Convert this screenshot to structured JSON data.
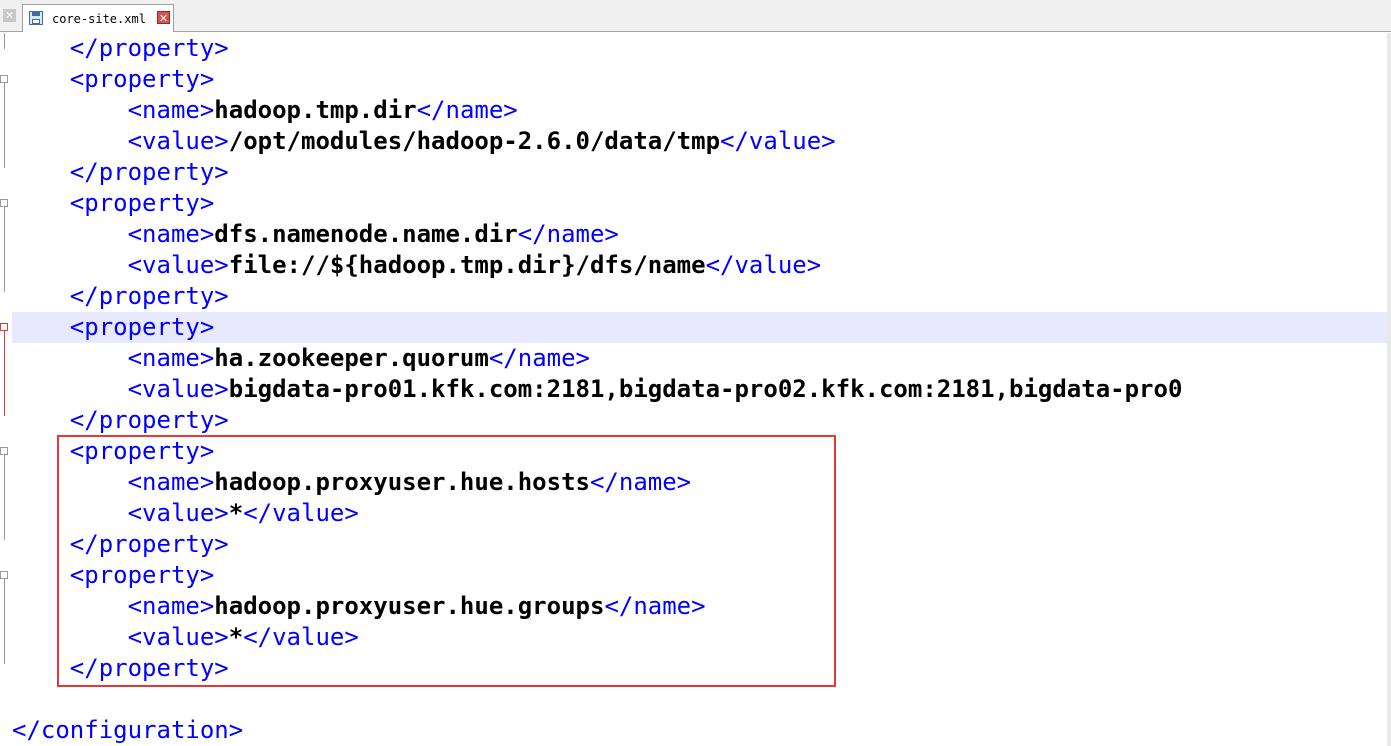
{
  "tabbar": {
    "close_all_glyph": "✕",
    "tab_label": "core-site.xml",
    "tab_close_glyph": "✕"
  },
  "code": {
    "lines": [
      {
        "indent": "    ",
        "open": "</property>",
        "text": "",
        "close": ""
      },
      {
        "indent": "    ",
        "open": "<property>",
        "text": "",
        "close": ""
      },
      {
        "indent": "        ",
        "open": "<name>",
        "text": "hadoop.tmp.dir",
        "close": "</name>"
      },
      {
        "indent": "        ",
        "open": "<value>",
        "text": "/opt/modules/hadoop-2.6.0/data/tmp",
        "close": "</value>"
      },
      {
        "indent": "    ",
        "open": "</property>",
        "text": "",
        "close": ""
      },
      {
        "indent": "    ",
        "open": "<property>",
        "text": "",
        "close": ""
      },
      {
        "indent": "        ",
        "open": "<name>",
        "text": "dfs.namenode.name.dir",
        "close": "</name>"
      },
      {
        "indent": "        ",
        "open": "<value>",
        "text": "file://${hadoop.tmp.dir}/dfs/name",
        "close": "</value>"
      },
      {
        "indent": "    ",
        "open": "</property>",
        "text": "",
        "close": ""
      },
      {
        "indent": "    ",
        "open": "<property>",
        "text": "",
        "close": ""
      },
      {
        "indent": "        ",
        "open": "<name>",
        "text": "ha.zookeeper.quorum",
        "close": "</name>"
      },
      {
        "indent": "        ",
        "open": "<value>",
        "text": "bigdata-pro01.kfk.com:2181,bigdata-pro02.kfk.com:2181,bigdata-pro0",
        "close": ""
      },
      {
        "indent": "    ",
        "open": "</property>",
        "text": "",
        "close": ""
      },
      {
        "indent": "    ",
        "open": "<property>",
        "text": "",
        "close": ""
      },
      {
        "indent": "        ",
        "open": "<name>",
        "text": "hadoop.proxyuser.hue.hosts",
        "close": "</name>"
      },
      {
        "indent": "        ",
        "open": "<value>",
        "text": "*",
        "close": "</value>"
      },
      {
        "indent": "    ",
        "open": "</property>",
        "text": "",
        "close": ""
      },
      {
        "indent": "    ",
        "open": "<property>",
        "text": "",
        "close": ""
      },
      {
        "indent": "        ",
        "open": "<name>",
        "text": "hadoop.proxyuser.hue.groups",
        "close": "</name>"
      },
      {
        "indent": "        ",
        "open": "<value>",
        "text": "*",
        "close": "</value>"
      },
      {
        "indent": "    ",
        "open": "</property>",
        "text": "",
        "close": ""
      },
      {
        "indent": "",
        "open": "",
        "text": "",
        "close": ""
      },
      {
        "indent": "",
        "open": "</configuration>",
        "text": "",
        "close": ""
      }
    ],
    "current_line_index": 9
  },
  "colors": {
    "tag": "#0000ff",
    "text": "#000000",
    "current_line_bg": "#e8e8ff",
    "highlight_border": "#e53935"
  }
}
